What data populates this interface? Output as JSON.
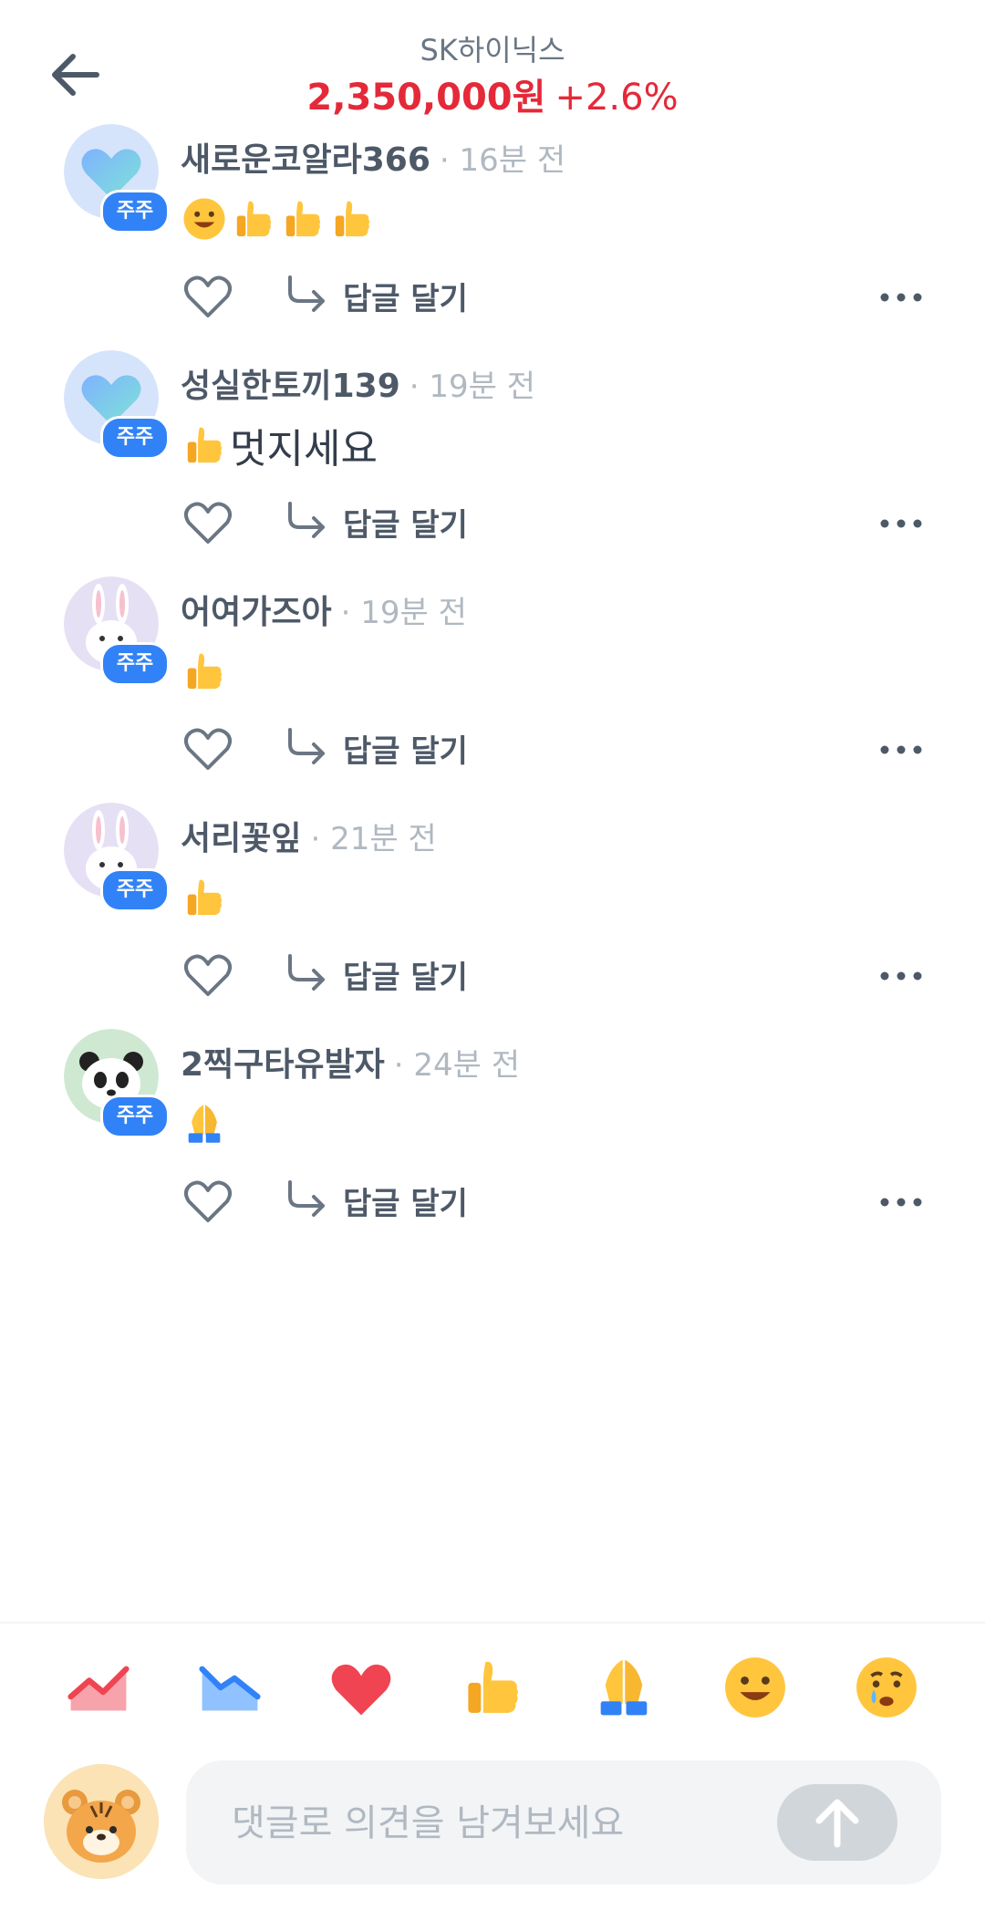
{
  "header": {
    "stock_name": "SK하이닉스",
    "price": "2,350,000원",
    "change": "+2.6%",
    "price_color": "#e42939"
  },
  "comments": [
    {
      "author": "새로운코알라366",
      "time": "· 16분 전",
      "badge": "주주",
      "avatar": "heart-avatar",
      "body_text": "",
      "emojis": [
        "smiley-emoji",
        "thumbs-up-emoji",
        "thumbs-up-emoji",
        "thumbs-up-emoji"
      ],
      "reply_label": "답글 달기"
    },
    {
      "author": "성실한토끼139",
      "time": "· 19분 전",
      "badge": "주주",
      "avatar": "heart-avatar",
      "body_text": "멋지세요",
      "emojis": [
        "thumbs-up-emoji"
      ],
      "reply_label": "답글 달기"
    },
    {
      "author": "어여가즈아",
      "time": "· 19분 전",
      "badge": "주주",
      "avatar": "rabbit-avatar",
      "body_text": "",
      "emojis": [
        "thumbs-up-emoji"
      ],
      "reply_label": "답글 달기"
    },
    {
      "author": "서리꽃잎",
      "time": "· 21분 전",
      "badge": "주주",
      "avatar": "rabbit-avatar",
      "body_text": "",
      "emojis": [
        "thumbs-up-emoji"
      ],
      "reply_label": "답글 달기"
    },
    {
      "author": "2찍구타유발자",
      "time": "· 24분 전",
      "badge": "주주",
      "avatar": "panda-avatar",
      "body_text": "",
      "emojis": [
        "folded-hands-emoji"
      ],
      "reply_label": "답글 달기"
    }
  ],
  "reactions": [
    "chart-up-icon",
    "chart-down-icon",
    "heart-icon",
    "thumbs-up-icon",
    "folded-hands-icon",
    "smiley-icon",
    "crying-face-icon"
  ],
  "input": {
    "placeholder": "댓글로 의견을 남겨보세요",
    "value": ""
  },
  "colors": {
    "accent": "#3182f6",
    "up": "#f04452",
    "down": "#3182f6",
    "emoji_yellow": "#ffc53d"
  }
}
